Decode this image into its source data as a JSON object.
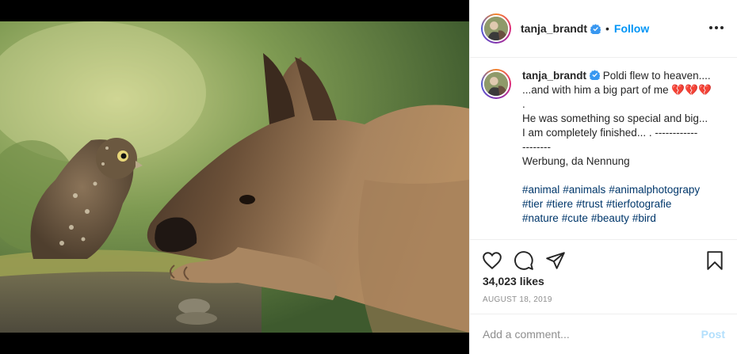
{
  "header": {
    "username": "tanja_brandt",
    "separator": "•",
    "follow_label": "Follow"
  },
  "caption": {
    "username": "tanja_brandt",
    "lines": [
      "Poldi flew to heaven....",
      "...and with him a big part of me 💔💔💔",
      ".",
      "He was something so special and big...",
      "I am completely finished... . ------------",
      "--------",
      "Werbung, da Nennung"
    ],
    "hashtags": [
      "#animal",
      "#animals",
      "#animalphotograpy",
      "#tier",
      "#tiere",
      "#trust",
      "#tierfotografie",
      "#nature",
      "#cute",
      "#beauty",
      "#bird"
    ]
  },
  "stats": {
    "likes": "34,023 likes",
    "date": "AUGUST 18, 2019"
  },
  "comment": {
    "placeholder": "Add a comment...",
    "post_label": "Post"
  },
  "colors": {
    "accent": "#0095f6",
    "hashtag": "#00376b",
    "muted": "#8e8e8e",
    "border": "#efefef",
    "post_disabled": "#b2dffc"
  },
  "icons": {
    "like": "heart-icon",
    "comment": "comment-icon",
    "share": "paper-plane-icon",
    "save": "bookmark-icon",
    "more": "more-options-icon",
    "verified": "verified-badge-icon"
  }
}
